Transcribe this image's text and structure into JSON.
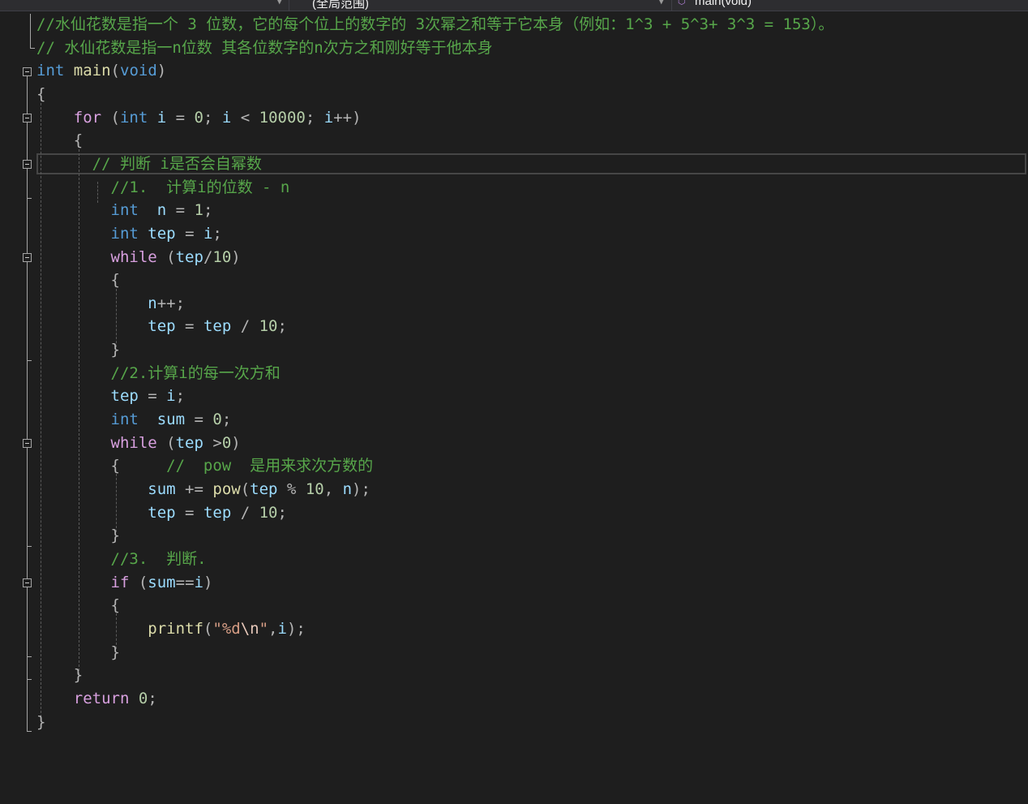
{
  "navbar": {
    "scope_label": "(全局范围)",
    "member_label": "main(void)",
    "member_icon": "method-cube-icon"
  },
  "colors": {
    "background": "#1e1e1e",
    "comment": "#57a64a",
    "keyword": "#569cd6",
    "control": "#d8a0df",
    "function": "#dcdcaa",
    "variable": "#9cdcfe",
    "number": "#b5cea8",
    "string": "#d69d85",
    "text": "#dcdcdc"
  },
  "code": {
    "lines": [
      [
        {
          "t": "//水仙花数是指一个 3 位数，它的每个位上的数字的 3次幂之和等于它本身（例如：1^3 + 5^3+ 3^3 = 153）。",
          "c": "cmt"
        }
      ],
      [
        {
          "t": "// 水仙花数是指一n位数 其各位数字的n次方之和刚好等于他本身",
          "c": "cmt"
        }
      ],
      [
        {
          "t": "int",
          "c": "kw"
        },
        {
          "t": " ",
          "c": ""
        },
        {
          "t": "main",
          "c": "fn"
        },
        {
          "t": "(",
          "c": "pun"
        },
        {
          "t": "void",
          "c": "kw"
        },
        {
          "t": ")",
          "c": "pun"
        }
      ],
      [
        {
          "t": "{",
          "c": "pun"
        }
      ],
      [
        {
          "t": "    ",
          "c": ""
        },
        {
          "t": "for",
          "c": "ctl"
        },
        {
          "t": " (",
          "c": "pun"
        },
        {
          "t": "int",
          "c": "kw"
        },
        {
          "t": " ",
          "c": ""
        },
        {
          "t": "i",
          "c": "var"
        },
        {
          "t": " = ",
          "c": "pun"
        },
        {
          "t": "0",
          "c": "num"
        },
        {
          "t": "; ",
          "c": "pun"
        },
        {
          "t": "i",
          "c": "var"
        },
        {
          "t": " < ",
          "c": "pun"
        },
        {
          "t": "10000",
          "c": "num"
        },
        {
          "t": "; ",
          "c": "pun"
        },
        {
          "t": "i",
          "c": "var"
        },
        {
          "t": "++)",
          "c": "pun"
        }
      ],
      [
        {
          "t": "    {",
          "c": "pun"
        }
      ],
      [
        {
          "t": "      ",
          "c": ""
        },
        {
          "t": "// 判断 i是否会自幂数",
          "c": "cmt"
        }
      ],
      [
        {
          "t": "        ",
          "c": ""
        },
        {
          "t": "//1.  计算i的位数 - n",
          "c": "cmt"
        }
      ],
      [
        {
          "t": "        ",
          "c": ""
        },
        {
          "t": "int",
          "c": "kw"
        },
        {
          "t": "  ",
          "c": ""
        },
        {
          "t": "n",
          "c": "var"
        },
        {
          "t": " = ",
          "c": "pun"
        },
        {
          "t": "1",
          "c": "num"
        },
        {
          "t": ";",
          "c": "pun"
        }
      ],
      [
        {
          "t": "        ",
          "c": ""
        },
        {
          "t": "int",
          "c": "kw"
        },
        {
          "t": " ",
          "c": ""
        },
        {
          "t": "tep",
          "c": "var"
        },
        {
          "t": " = ",
          "c": "pun"
        },
        {
          "t": "i",
          "c": "var"
        },
        {
          "t": ";",
          "c": "pun"
        }
      ],
      [
        {
          "t": "        ",
          "c": ""
        },
        {
          "t": "while",
          "c": "ctl"
        },
        {
          "t": " (",
          "c": "pun"
        },
        {
          "t": "tep",
          "c": "var"
        },
        {
          "t": "/",
          "c": "pun"
        },
        {
          "t": "10",
          "c": "num"
        },
        {
          "t": ")",
          "c": "pun"
        }
      ],
      [
        {
          "t": "        {",
          "c": "pun"
        }
      ],
      [
        {
          "t": "            ",
          "c": ""
        },
        {
          "t": "n",
          "c": "var"
        },
        {
          "t": "++;",
          "c": "pun"
        }
      ],
      [
        {
          "t": "            ",
          "c": ""
        },
        {
          "t": "tep",
          "c": "var"
        },
        {
          "t": " = ",
          "c": "pun"
        },
        {
          "t": "tep",
          "c": "var"
        },
        {
          "t": " / ",
          "c": "pun"
        },
        {
          "t": "10",
          "c": "num"
        },
        {
          "t": ";",
          "c": "pun"
        }
      ],
      [
        {
          "t": "        }",
          "c": "pun"
        }
      ],
      [
        {
          "t": "        ",
          "c": ""
        },
        {
          "t": "//2.计算i的每一次方和",
          "c": "cmt"
        }
      ],
      [
        {
          "t": "        ",
          "c": ""
        },
        {
          "t": "tep",
          "c": "var"
        },
        {
          "t": " = ",
          "c": "pun"
        },
        {
          "t": "i",
          "c": "var"
        },
        {
          "t": ";",
          "c": "pun"
        }
      ],
      [
        {
          "t": "        ",
          "c": ""
        },
        {
          "t": "int",
          "c": "kw"
        },
        {
          "t": "  ",
          "c": ""
        },
        {
          "t": "sum",
          "c": "var"
        },
        {
          "t": " = ",
          "c": "pun"
        },
        {
          "t": "0",
          "c": "num"
        },
        {
          "t": ";",
          "c": "pun"
        }
      ],
      [
        {
          "t": "        ",
          "c": ""
        },
        {
          "t": "while",
          "c": "ctl"
        },
        {
          "t": " (",
          "c": "pun"
        },
        {
          "t": "tep",
          "c": "var"
        },
        {
          "t": " >",
          "c": "pun"
        },
        {
          "t": "0",
          "c": "num"
        },
        {
          "t": ")",
          "c": "pun"
        }
      ],
      [
        {
          "t": "        {     ",
          "c": "pun"
        },
        {
          "t": "//  pow  是用来求次方数的",
          "c": "cmt"
        }
      ],
      [
        {
          "t": "            ",
          "c": ""
        },
        {
          "t": "sum",
          "c": "var"
        },
        {
          "t": " += ",
          "c": "pun"
        },
        {
          "t": "pow",
          "c": "fn"
        },
        {
          "t": "(",
          "c": "pun"
        },
        {
          "t": "tep",
          "c": "var"
        },
        {
          "t": " % ",
          "c": "pun"
        },
        {
          "t": "10",
          "c": "num"
        },
        {
          "t": ", ",
          "c": "pun"
        },
        {
          "t": "n",
          "c": "var"
        },
        {
          "t": ");",
          "c": "pun"
        }
      ],
      [
        {
          "t": "            ",
          "c": ""
        },
        {
          "t": "tep",
          "c": "var"
        },
        {
          "t": " = ",
          "c": "pun"
        },
        {
          "t": "tep",
          "c": "var"
        },
        {
          "t": " / ",
          "c": "pun"
        },
        {
          "t": "10",
          "c": "num"
        },
        {
          "t": ";",
          "c": "pun"
        }
      ],
      [
        {
          "t": "        }",
          "c": "pun"
        }
      ],
      [
        {
          "t": "        ",
          "c": ""
        },
        {
          "t": "//3.  判断.",
          "c": "cmt"
        }
      ],
      [
        {
          "t": "        ",
          "c": ""
        },
        {
          "t": "if",
          "c": "ctl"
        },
        {
          "t": " (",
          "c": "pun"
        },
        {
          "t": "sum",
          "c": "var"
        },
        {
          "t": "==",
          "c": "pun"
        },
        {
          "t": "i",
          "c": "var"
        },
        {
          "t": ")",
          "c": "pun"
        }
      ],
      [
        {
          "t": "        {",
          "c": "pun"
        }
      ],
      [
        {
          "t": "            ",
          "c": ""
        },
        {
          "t": "printf",
          "c": "fn"
        },
        {
          "t": "(",
          "c": "pun"
        },
        {
          "t": "\"%d",
          "c": "str"
        },
        {
          "t": "\\n",
          "c": "esc"
        },
        {
          "t": "\"",
          "c": "str"
        },
        {
          "t": ",",
          "c": "pun"
        },
        {
          "t": "i",
          "c": "var"
        },
        {
          "t": ");",
          "c": "pun"
        }
      ],
      [
        {
          "t": "        }",
          "c": "pun"
        }
      ],
      [
        {
          "t": "    }",
          "c": "pun"
        }
      ],
      [
        {
          "t": "    ",
          "c": ""
        },
        {
          "t": "return",
          "c": "ctl"
        },
        {
          "t": " ",
          "c": ""
        },
        {
          "t": "0",
          "c": "num"
        },
        {
          "t": ";",
          "c": "pun"
        }
      ],
      [
        {
          "t": "}",
          "c": "pun"
        }
      ]
    ]
  }
}
